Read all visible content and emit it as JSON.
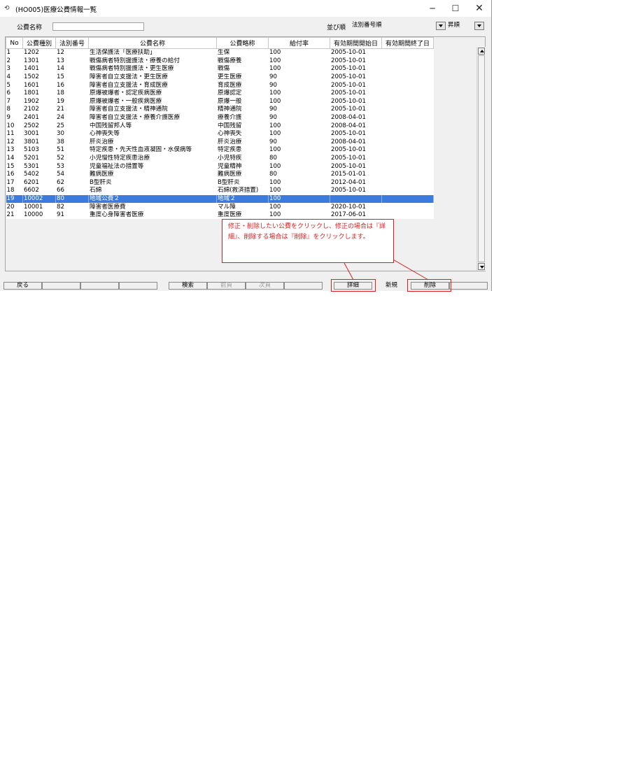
{
  "window": {
    "icon": "link-icon",
    "title": "(HO005)医療公費情報一覧",
    "controls": [
      "─",
      "☐",
      "✕"
    ]
  },
  "filter": {
    "name_label": "公費名称",
    "name_value": "",
    "sort_label": "並び順",
    "sort_value": "法別番号順",
    "order_value": "昇順"
  },
  "table": {
    "columns": [
      "No",
      "公費種別",
      "法別番号",
      "公費名称",
      "公費略称",
      "給付率",
      "有効期間開始日",
      "有効期間終了日"
    ],
    "selected_row": 19,
    "rows": [
      [
        "1",
        "1202",
        "12",
        "生活保護法「医療扶助」",
        "生保",
        "100",
        "2005-10-01",
        ""
      ],
      [
        "2",
        "1301",
        "13",
        "戦傷病者特別援護法・療養の給付",
        "戦傷療養",
        "100",
        "2005-10-01",
        ""
      ],
      [
        "3",
        "1401",
        "14",
        "戦傷病者特別援護法・更生医療",
        "戦傷",
        "100",
        "2005-10-01",
        ""
      ],
      [
        "4",
        "1502",
        "15",
        "障害者自立支援法・更生医療",
        "更生医療",
        "90",
        "2005-10-01",
        ""
      ],
      [
        "5",
        "1601",
        "16",
        "障害者自立支援法・育成医療",
        "育成医療",
        "90",
        "2005-10-01",
        ""
      ],
      [
        "6",
        "1801",
        "18",
        "原爆被爆者・認定疾病医療",
        "原爆認定",
        "100",
        "2005-10-01",
        ""
      ],
      [
        "7",
        "1902",
        "19",
        "原爆被爆者・一般疾病医療",
        "原爆一般",
        "100",
        "2005-10-01",
        ""
      ],
      [
        "8",
        "2102",
        "21",
        "障害者自立支援法・精神通院",
        "精神通院",
        "90",
        "2005-10-01",
        ""
      ],
      [
        "9",
        "2401",
        "24",
        "障害者自立支援法・療養介護医療",
        "療養介護",
        "90",
        "2008-04-01",
        ""
      ],
      [
        "10",
        "2502",
        "25",
        "中国残留邦人等",
        "中国残留",
        "100",
        "2008-04-01",
        ""
      ],
      [
        "11",
        "3001",
        "30",
        "心神喪失等",
        "心神喪失",
        "100",
        "2005-10-01",
        ""
      ],
      [
        "12",
        "3801",
        "38",
        "肝炎治療",
        "肝炎治療",
        "90",
        "2008-04-01",
        ""
      ],
      [
        "13",
        "5103",
        "51",
        "特定疾患・先天性血液凝固・水俣病等",
        "特定疾患",
        "100",
        "2005-10-01",
        ""
      ],
      [
        "14",
        "5201",
        "52",
        "小児慢性特定疾患治療",
        "小児特疾",
        "80",
        "2005-10-01",
        ""
      ],
      [
        "15",
        "5301",
        "53",
        "児童福祉法の措置等",
        "児童精神",
        "100",
        "2005-10-01",
        ""
      ],
      [
        "16",
        "5402",
        "54",
        "難病医療",
        "難病医療",
        "80",
        "2015-01-01",
        ""
      ],
      [
        "17",
        "6201",
        "62",
        "B型肝炎",
        "B型肝炎",
        "100",
        "2012-04-01",
        ""
      ],
      [
        "18",
        "6602",
        "66",
        "石綿",
        "石綿(救済措置)",
        "100",
        "2005-10-01",
        ""
      ],
      [
        "19",
        "10002",
        "80",
        "地域公費２",
        "地域２",
        "100",
        "",
        ""
      ],
      [
        "20",
        "10001",
        "82",
        "障害者医療費",
        "マル障",
        "100",
        "2020-10-01",
        ""
      ],
      [
        "21",
        "10000",
        "91",
        "重度心身障害者医療",
        "重度医療",
        "100",
        "2017-06-01",
        ""
      ]
    ]
  },
  "footer": {
    "back": "戻る",
    "search": "検索",
    "prev": "前頁",
    "next": "次頁",
    "detail": "詳細",
    "new": "新規",
    "delete": "削除"
  },
  "annotation": {
    "text": "修正・削除したい公費をクリックし、修正の場合は『詳細』、削除する場合は『削除』をクリックします。",
    "color": "#d82020"
  },
  "colors": {
    "selection": "#3b7bdd",
    "window_bg": "#f0f0f0"
  }
}
